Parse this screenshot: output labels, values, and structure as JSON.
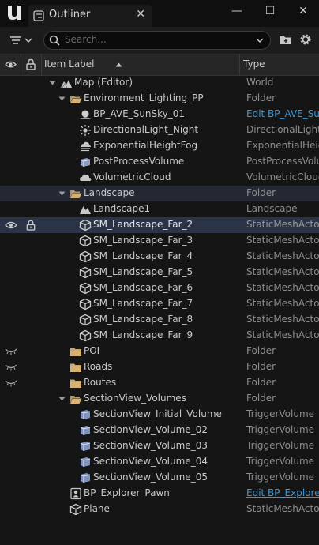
{
  "tab": {
    "title": "Outliner"
  },
  "window": {
    "minimize": "—",
    "maximize": "☐",
    "close": "✕"
  },
  "search": {
    "placeholder": "Search..."
  },
  "columns": {
    "label": "Item Label",
    "type": "Type"
  },
  "rows": [
    {
      "label": "Map (Editor)",
      "type": "World",
      "icon": "map-icon",
      "depth": 0,
      "expanded": true
    },
    {
      "label": "Environment_Lighting_PP",
      "type": "Folder",
      "icon": "folder-open-icon",
      "depth": 1,
      "expanded": true
    },
    {
      "label": "BP_AVE_SunSky_01",
      "type": "Edit BP_AVE_SunSky",
      "icon": "sunsky-icon",
      "depth": 2,
      "link": true
    },
    {
      "label": "DirectionalLight_Night",
      "type": "DirectionalLight",
      "icon": "directional-light-icon",
      "depth": 2
    },
    {
      "label": "ExponentialHeightFog",
      "type": "ExponentialHeightFog",
      "icon": "fog-icon",
      "depth": 2
    },
    {
      "label": "PostProcessVolume",
      "type": "PostProcessVolume",
      "icon": "postprocess-icon",
      "depth": 2
    },
    {
      "label": "VolumetricCloud",
      "type": "VolumetricCloud",
      "icon": "cloud-icon",
      "depth": 2
    },
    {
      "label": "Landscape",
      "type": "Folder",
      "icon": "folder-open-icon",
      "depth": 1,
      "expanded": true,
      "folder_selected": true
    },
    {
      "label": "Landscape1",
      "type": "Landscape",
      "icon": "landscape-icon",
      "depth": 2
    },
    {
      "label": "SM_Landscape_Far_2",
      "type": "StaticMeshActor",
      "icon": "static-mesh-icon",
      "depth": 2,
      "selected": true,
      "visible": true,
      "locked": true
    },
    {
      "label": "SM_Landscape_Far_3",
      "type": "StaticMeshActor",
      "icon": "static-mesh-icon",
      "depth": 2
    },
    {
      "label": "SM_Landscape_Far_4",
      "type": "StaticMeshActor",
      "icon": "static-mesh-icon",
      "depth": 2
    },
    {
      "label": "SM_Landscape_Far_5",
      "type": "StaticMeshActor",
      "icon": "static-mesh-icon",
      "depth": 2
    },
    {
      "label": "SM_Landscape_Far_6",
      "type": "StaticMeshActor",
      "icon": "static-mesh-icon",
      "depth": 2
    },
    {
      "label": "SM_Landscape_Far_7",
      "type": "StaticMeshActor",
      "icon": "static-mesh-icon",
      "depth": 2
    },
    {
      "label": "SM_Landscape_Far_8",
      "type": "StaticMeshActor",
      "icon": "static-mesh-icon",
      "depth": 2
    },
    {
      "label": "SM_Landscape_Far_9",
      "type": "StaticMeshActor",
      "icon": "static-mesh-icon",
      "depth": 2
    },
    {
      "label": "POI",
      "type": "Folder",
      "icon": "folder-closed-icon",
      "depth": 1,
      "hidden": true
    },
    {
      "label": "Roads",
      "type": "Folder",
      "icon": "folder-closed-icon",
      "depth": 1,
      "hidden": true
    },
    {
      "label": "Routes",
      "type": "Folder",
      "icon": "folder-closed-icon",
      "depth": 1,
      "hidden": true
    },
    {
      "label": "SectionView_Volumes",
      "type": "Folder",
      "icon": "folder-open-icon",
      "depth": 1,
      "expanded": true
    },
    {
      "label": "SectionView_Initial_Volume",
      "type": "TriggerVolume",
      "icon": "trigger-volume-icon",
      "depth": 2
    },
    {
      "label": "SectionView_Volume_02",
      "type": "TriggerVolume",
      "icon": "trigger-volume-icon",
      "depth": 2
    },
    {
      "label": "SectionView_Volume_03",
      "type": "TriggerVolume",
      "icon": "trigger-volume-icon",
      "depth": 2
    },
    {
      "label": "SectionView_Volume_04",
      "type": "TriggerVolume",
      "icon": "trigger-volume-icon",
      "depth": 2
    },
    {
      "label": "SectionView_Volume_05",
      "type": "TriggerVolume",
      "icon": "trigger-volume-icon",
      "depth": 2
    },
    {
      "label": "BP_Explorer_Pawn",
      "type": "Edit BP_Explorer",
      "icon": "pawn-icon",
      "depth": 1,
      "link": true
    },
    {
      "label": "Plane",
      "type": "StaticMeshActor",
      "icon": "static-mesh-icon",
      "depth": 1
    }
  ],
  "colors": {
    "selected_row": "#2b3447",
    "link": "#3a98d8",
    "background": "#151515"
  }
}
